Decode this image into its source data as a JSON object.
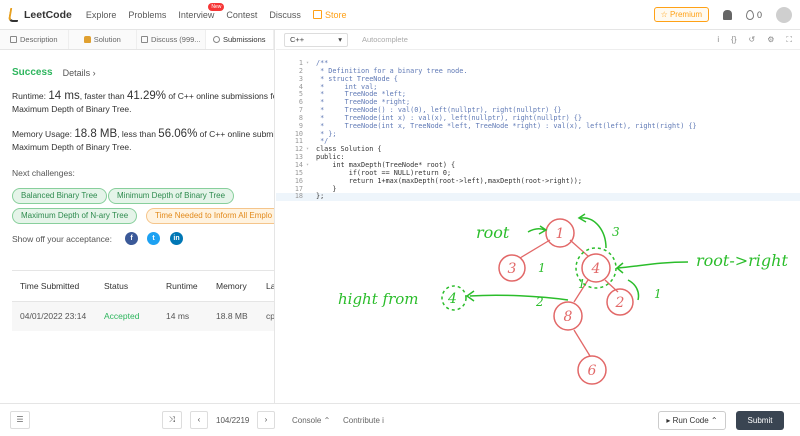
{
  "nav": {
    "brand": "LeetCode",
    "links": [
      "Explore",
      "Problems",
      "Interview",
      "Contest",
      "Discuss"
    ],
    "interview_badge": "New",
    "store": "Store",
    "premium": "☆ Premium",
    "coins": "0"
  },
  "tabs": {
    "description": "Description",
    "solution": "Solution",
    "discuss": "Discuss (999...",
    "submissions": "Submissions"
  },
  "result": {
    "status": "Success",
    "details": "Details ›",
    "runtime_pre": "Runtime: ",
    "runtime_value": "14 ms",
    "runtime_mid": ", faster than ",
    "runtime_pct": "41.29%",
    "runtime_post": " of C++ online submissions for",
    "runtime_line2": "Maximum Depth of Binary Tree.",
    "memory_pre": "Memory Usage: ",
    "memory_value": "18.8 MB",
    "memory_mid": ", less than ",
    "memory_pct": "56.06%",
    "memory_post": " of C++ online submissi",
    "memory_line2": "Maximum Depth of Binary Tree."
  },
  "challenges": {
    "title": "Next challenges:",
    "items": [
      "Balanced Binary Tree",
      "Minimum Depth of Binary Tree",
      "Maximum Depth of N-ary Tree",
      "Time Needed to Inform All Emplo"
    ]
  },
  "share": {
    "label": "Show off your acceptance:",
    "facebook": "f",
    "twitter": "t",
    "linkedin": "in"
  },
  "submissions_table": {
    "headers": [
      "Time Submitted",
      "Status",
      "Runtime",
      "Memory",
      "La"
    ],
    "rows": [
      [
        "04/01/2022 23:14",
        "Accepted",
        "14 ms",
        "18.8 MB",
        "cp"
      ]
    ]
  },
  "editor": {
    "language": "C++",
    "autocomplete": "Autocomplete",
    "toolbar_icons": [
      "i",
      "{}",
      "↺",
      "⚙",
      "⛶"
    ],
    "lines": [
      "/**",
      " * Definition for a binary tree node.",
      " * struct TreeNode {",
      " *     int val;",
      " *     TreeNode *left;",
      " *     TreeNode *right;",
      " *     TreeNode() : val(0), left(nullptr), right(nullptr) {}",
      " *     TreeNode(int x) : val(x), left(nullptr), right(nullptr) {}",
      " *     TreeNode(int x, TreeNode *left, TreeNode *right) : val(x), left(left), right(right) {}",
      " * };",
      " */",
      "class Solution {",
      "public:",
      "    int maxDepth(TreeNode* root) {",
      "        if(root == NULL)return 0;",
      "        return 1+max(maxDepth(root->left),maxDepth(root->right));",
      "    }",
      "};"
    ],
    "line_numbers": [
      "1",
      "2",
      "3",
      "4",
      "5",
      "6",
      "7",
      "8",
      "9",
      "10",
      "11",
      "12",
      "13",
      "14",
      "15",
      "16",
      "17",
      "18"
    ]
  },
  "bottom": {
    "list_icon": "☰",
    "shuffle": "⤨",
    "prev": "‹",
    "page": "104/2219",
    "next": "›",
    "console": "Console ⌃",
    "contribute": "Contribute i",
    "run_code": "▸ Run Code ⌃",
    "submit": "Submit"
  },
  "annotation": {
    "root_label": "root",
    "root_right_label": "root->right",
    "height_label": "hight from",
    "nodes": [
      "1",
      "3",
      "4",
      "8",
      "2",
      "6"
    ],
    "side_numbers": [
      "3",
      "1",
      "1",
      "2",
      "1"
    ],
    "ink_color": "#2bbd2b",
    "node_color": "#e26868"
  },
  "colors": {
    "accent": "#ffa116",
    "success": "#2db55d",
    "submit_bg": "#3a4552"
  }
}
